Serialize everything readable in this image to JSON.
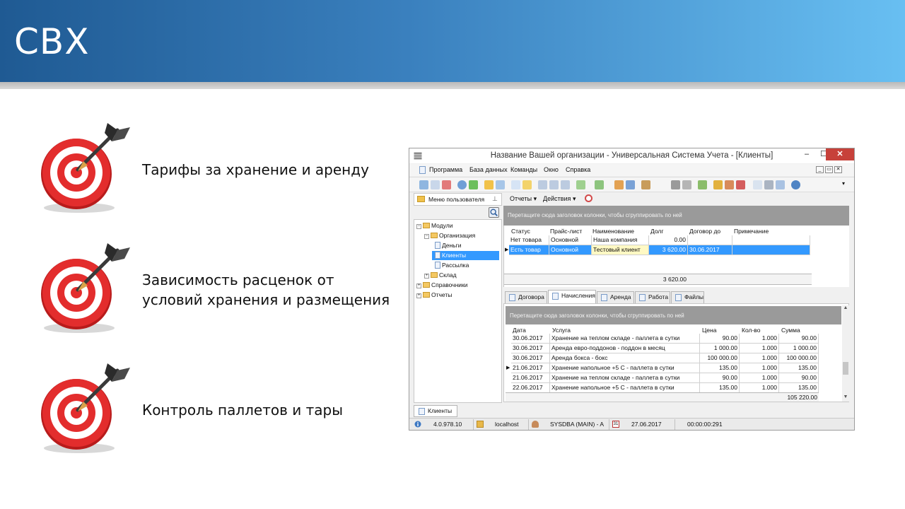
{
  "slide": {
    "title": "CBX",
    "bullets": [
      {
        "lines": [
          "Тарифы за хранение и аренду"
        ]
      },
      {
        "lines": [
          "Зависимость расценок от",
          "условий хранения и размещения"
        ]
      },
      {
        "lines": [
          "Контроль паллетов и тары"
        ]
      }
    ]
  },
  "app": {
    "window_title": "Название Вашей организации - Универсальная Система Учета - [Клиенты]",
    "controls": {
      "minimize": "–",
      "maximize": "☐",
      "close": "✕"
    },
    "menu": [
      "Программа",
      "База данных",
      "Команды",
      "Окно",
      "Справка"
    ],
    "user_menu": {
      "header": "Меню пользователя",
      "tree": [
        {
          "label": "Модули",
          "level": 0,
          "toggle": "−",
          "kind": "folder"
        },
        {
          "label": "Организация",
          "level": 1,
          "toggle": "−",
          "kind": "folder"
        },
        {
          "label": "Деньги",
          "level": 2,
          "toggle": "",
          "kind": "doc"
        },
        {
          "label": "Клиенты",
          "level": 2,
          "toggle": "",
          "kind": "doc",
          "selected": true
        },
        {
          "label": "Рассылка",
          "level": 2,
          "toggle": "",
          "kind": "doc"
        },
        {
          "label": "Склад",
          "level": 1,
          "toggle": "+",
          "kind": "folder"
        },
        {
          "label": "Справочники",
          "level": 0,
          "toggle": "+",
          "kind": "folder"
        },
        {
          "label": "Отчеты",
          "level": 0,
          "toggle": "+",
          "kind": "folder"
        }
      ]
    },
    "actions": {
      "reports": "Отчеты",
      "actions": "Действия"
    },
    "group_hint": "Перетащите сюда заголовок колонки, чтобы сгруппировать по ней",
    "clients_grid": {
      "columns": [
        "Статус",
        "Прайс-лист",
        "Наименование",
        "Долг",
        "Договор до",
        "Примечание"
      ],
      "rows": [
        [
          "Нет товара",
          "Основной",
          "Наша компания",
          "0.00",
          "",
          ""
        ],
        [
          "Есть товар",
          "Основной",
          "Тестовый клиент",
          "3 620.00",
          "30.06.2017",
          ""
        ]
      ],
      "total": "3 620.00"
    },
    "detail_tabs": [
      "Договора",
      "Начисления",
      "Аренда",
      "Работа",
      "Файлы"
    ],
    "active_tab": "Начисления",
    "charges_grid": {
      "columns": [
        "Дата",
        "Услуга",
        "Цена",
        "Кол-во",
        "Сумма"
      ],
      "rows": [
        [
          "30.06.2017",
          "Хранение на теплом складе - паллета в сутки",
          "90.00",
          "1.000",
          "90.00"
        ],
        [
          "30.06.2017",
          "Аренда евро-поддонов - поддон в месяц",
          "1 000.00",
          "1.000",
          "1 000.00"
        ],
        [
          "30.06.2017",
          "Аренда бокса - бокс",
          "100 000.00",
          "1.000",
          "100 000.00"
        ],
        [
          "21.06.2017",
          "Хранение напольное +5 С - паллета в сутки",
          "135.00",
          "1.000",
          "135.00"
        ],
        [
          "21.06.2017",
          "Хранение на теплом складе - паллета в сутки",
          "90.00",
          "1.000",
          "90.00"
        ],
        [
          "22.06.2017",
          "Хранение напольное +5 С - паллета в сутки",
          "135.00",
          "1.000",
          "135.00"
        ]
      ],
      "total": "105 220.00"
    },
    "bottom_tab": "Клиенты",
    "status": {
      "version": "4.0.978.10",
      "host": "localhost",
      "user": "SYSDBA (MAIN) - A",
      "date": "27.06.2017",
      "timer": "00:00:00:291"
    }
  }
}
